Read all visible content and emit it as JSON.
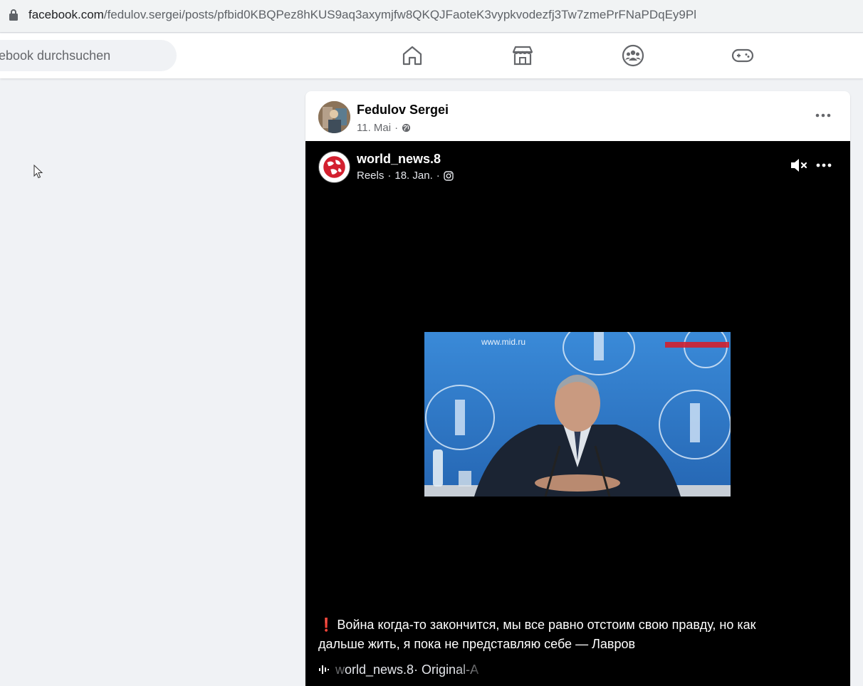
{
  "browser": {
    "url_domain": "facebook.com",
    "url_path": "/fedulov.sergei/posts/pfbid0KBQPez8hKUS9aq3axymjfw8QKQJFaoteK3vypkvodezfj3Tw7zmePrFNaPDqEy9Pl"
  },
  "header": {
    "search_placeholder": "ebook durchsuchen",
    "nav": [
      "home-icon",
      "marketplace-icon",
      "groups-icon",
      "gaming-icon"
    ]
  },
  "post": {
    "author": "Fedulov Sergei",
    "date": "11. Mai",
    "separator": "·",
    "reel": {
      "user": "world_news.8",
      "source": "Reels",
      "date": "18. Jan.",
      "separator": "·",
      "video_overlay_text": "www.mid.ru",
      "caption": "Война когда-то закончится, мы все равно отстоим свою правду, но как дальше жить, я пока не представляю себе — Лавров",
      "audio_prefix": "w",
      "audio_user": "orld_news.8",
      "audio_label": " · Original-A"
    }
  },
  "colors": {
    "fb_blue": "#1877f2",
    "background": "#f0f2f5",
    "warning_red": "#e4212e"
  }
}
